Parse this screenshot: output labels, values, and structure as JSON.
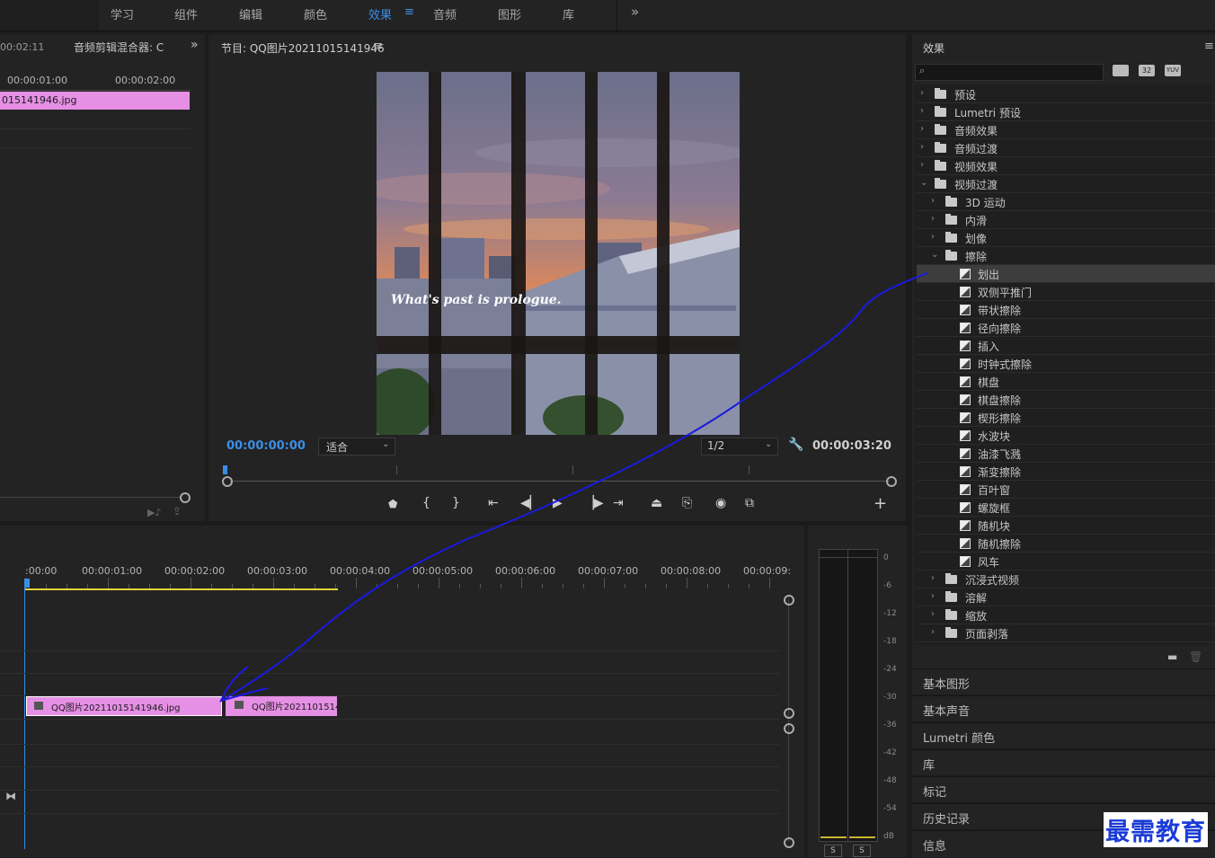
{
  "topbar": {
    "tabs": [
      {
        "label": "学习",
        "active": false
      },
      {
        "label": "组件",
        "active": false
      },
      {
        "label": "编辑",
        "active": false
      },
      {
        "label": "颜色",
        "active": false
      },
      {
        "label": "效果",
        "active": true
      },
      {
        "label": "音频",
        "active": false
      },
      {
        "label": "图形",
        "active": false
      },
      {
        "label": "库",
        "active": false
      }
    ],
    "active_menu_icon": "≡",
    "more_icon": "»"
  },
  "source_panel": {
    "timecode_left": "00:02:11",
    "title": "音频剪辑混合器: C",
    "ruler": [
      "00:00:01:00",
      "00:00:02:00"
    ],
    "clip_label": "015141946.jpg"
  },
  "program_monitor": {
    "title": "节目: QQ图片20211015141946",
    "overlay_text": "What's past is prologue.",
    "current_time": "00:00:00:00",
    "fit_select": "适合",
    "resolution_select": "1/2",
    "duration": "00:00:03:20",
    "colors": {
      "timecode": "#3b8ee8"
    }
  },
  "effects_panel": {
    "title": "效果",
    "search_placeholder": "",
    "filter_badges": [
      "32",
      "YUV"
    ],
    "tree": [
      {
        "label": "预设",
        "level": 0,
        "kind": "preset",
        "expanded": false
      },
      {
        "label": "Lumetri 预设",
        "level": 0,
        "kind": "preset",
        "expanded": false
      },
      {
        "label": "音频效果",
        "level": 0,
        "kind": "folder",
        "expanded": false
      },
      {
        "label": "音频过渡",
        "level": 0,
        "kind": "folder",
        "expanded": false
      },
      {
        "label": "视频效果",
        "level": 0,
        "kind": "folder",
        "expanded": false
      },
      {
        "label": "视频过渡",
        "level": 0,
        "kind": "folder",
        "expanded": true
      },
      {
        "label": "3D 运动",
        "level": 1,
        "kind": "folder",
        "expanded": false
      },
      {
        "label": "内滑",
        "level": 1,
        "kind": "folder",
        "expanded": false
      },
      {
        "label": "划像",
        "level": 1,
        "kind": "folder",
        "expanded": false
      },
      {
        "label": "擦除",
        "level": 1,
        "kind": "folder",
        "expanded": true
      },
      {
        "label": "划出",
        "level": 2,
        "kind": "effect",
        "selected": true
      },
      {
        "label": "双侧平推门",
        "level": 2,
        "kind": "effect"
      },
      {
        "label": "带状擦除",
        "level": 2,
        "kind": "effect"
      },
      {
        "label": "径向擦除",
        "level": 2,
        "kind": "effect"
      },
      {
        "label": "插入",
        "level": 2,
        "kind": "effect"
      },
      {
        "label": "时钟式擦除",
        "level": 2,
        "kind": "effect"
      },
      {
        "label": "棋盘",
        "level": 2,
        "kind": "effect"
      },
      {
        "label": "棋盘擦除",
        "level": 2,
        "kind": "effect"
      },
      {
        "label": "楔形擦除",
        "level": 2,
        "kind": "effect"
      },
      {
        "label": "水波块",
        "level": 2,
        "kind": "effect"
      },
      {
        "label": "油漆飞溅",
        "level": 2,
        "kind": "effect"
      },
      {
        "label": "渐变擦除",
        "level": 2,
        "kind": "effect"
      },
      {
        "label": "百叶窗",
        "level": 2,
        "kind": "effect"
      },
      {
        "label": "螺旋框",
        "level": 2,
        "kind": "effect"
      },
      {
        "label": "随机块",
        "level": 2,
        "kind": "effect"
      },
      {
        "label": "随机擦除",
        "level": 2,
        "kind": "effect"
      },
      {
        "label": "风车",
        "level": 2,
        "kind": "effect"
      },
      {
        "label": "沉浸式视频",
        "level": 1,
        "kind": "folder",
        "expanded": false
      },
      {
        "label": "溶解",
        "level": 1,
        "kind": "folder",
        "expanded": false
      },
      {
        "label": "缩放",
        "level": 1,
        "kind": "folder",
        "expanded": false
      },
      {
        "label": "页面剥落",
        "level": 1,
        "kind": "folder",
        "expanded": false
      }
    ]
  },
  "collapsed_panels": [
    "基本图形",
    "基本声音",
    "Lumetri 颜色",
    "库",
    "标记",
    "历史记录",
    "信息"
  ],
  "timeline": {
    "ruler": [
      ":00:00",
      "00:00:01:00",
      "00:00:02:00",
      "00:00:03:00",
      "00:00:04:00",
      "00:00:05:00",
      "00:00:06:00",
      "00:00:07:00",
      "00:00:08:00",
      "00:00:09:"
    ],
    "clips": [
      {
        "label": "QQ图片20211015141946.jpg"
      },
      {
        "label": "QQ图片20211015141"
      }
    ],
    "colors": {
      "clip": "#e58fe5",
      "work_area": "#e5d23a",
      "playhead": "#3b8ee8"
    }
  },
  "audio_meter": {
    "scale": [
      "0",
      "-6",
      "-12",
      "-18",
      "-24",
      "-30",
      "-36",
      "-42",
      "-48",
      "-54",
      "dB"
    ],
    "solo_buttons": [
      "S",
      "S"
    ]
  },
  "watermark": "最需教育"
}
